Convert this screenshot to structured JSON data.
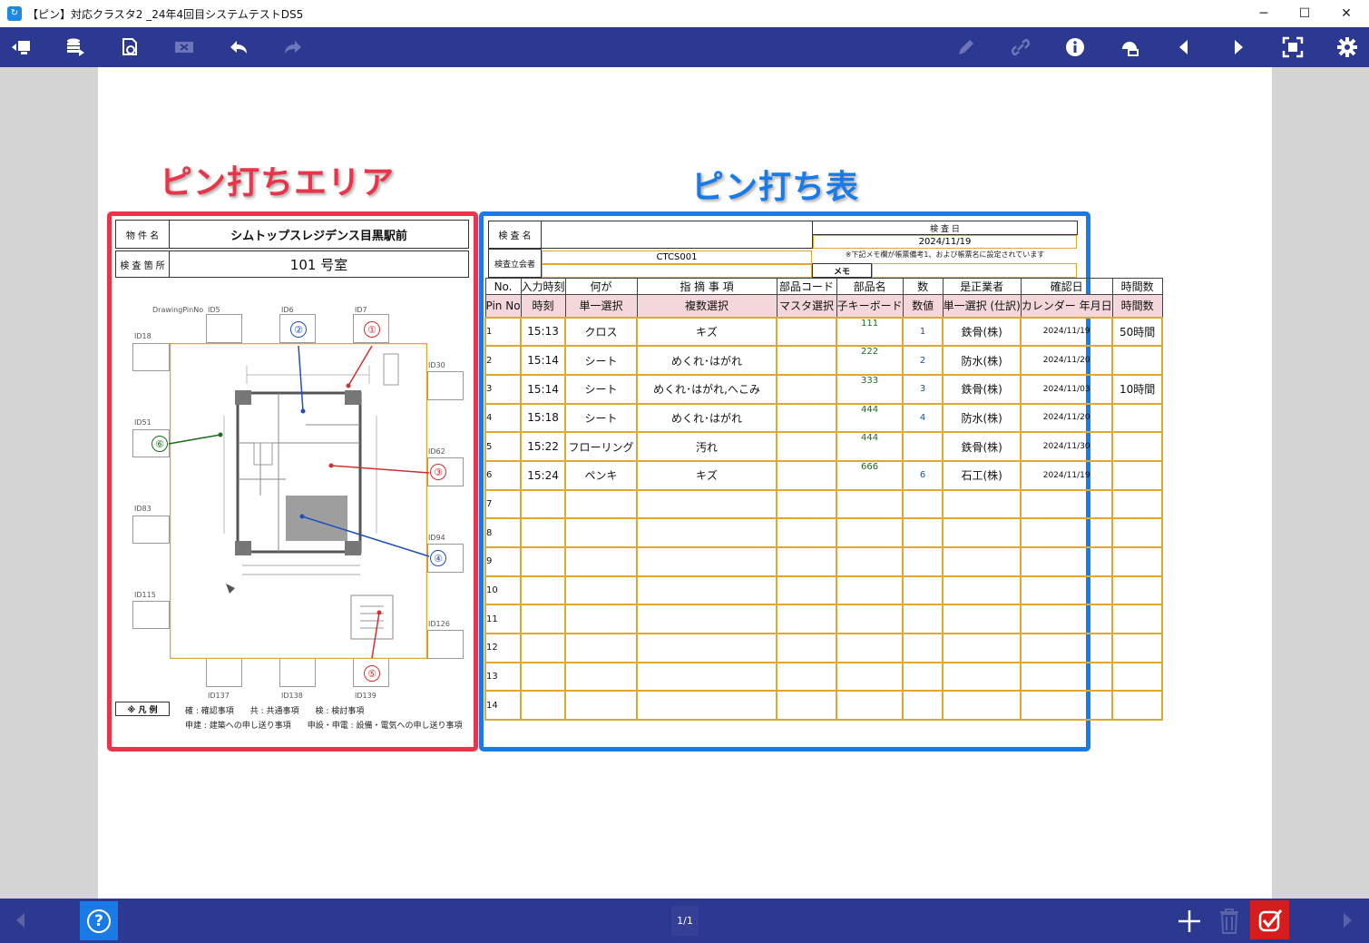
{
  "window": {
    "title": "【ピン】対応クラスタ2 _24年4回目システムテストDS5"
  },
  "toolbar": {
    "icons": [
      "exit-icon",
      "data-icon",
      "reload-icon",
      "delete-x-icon",
      "undo-icon",
      "redo-icon",
      "pen-icon",
      "link-icon",
      "info-icon",
      "cloud-icon",
      "prev-icon",
      "next-icon",
      "fit-icon",
      "gear-icon"
    ]
  },
  "headings": {
    "pin_area": "ピン打ちエリア",
    "pin_table": "ピン打ち表"
  },
  "pin_sheet": {
    "property_label": "物 件 名",
    "property_value": "シムトップスレジデンス目黒駅前",
    "location_label": "検 査 箇 所",
    "location_value": "101 号室",
    "drawing_label": "DrawingPinNo",
    "ids": [
      "ID5",
      "ID6",
      "ID7",
      "ID18",
      "ID30",
      "ID51",
      "ID62",
      "ID83",
      "ID94",
      "ID115",
      "ID126",
      "ID137",
      "ID138",
      "ID139"
    ],
    "pins": [
      "①",
      "②",
      "③",
      "④",
      "⑤",
      "⑥"
    ],
    "legend_label": "※ 凡 例",
    "legend_line1": "確 : 確認事項　　共 : 共通事項　　検 : 検討事項",
    "legend_line2": "申建 : 建築への申し送り事項　　申設・申電 : 設備・電気への申し送り事項"
  },
  "pin_table": {
    "inspector_label": "検 査 名",
    "inspector_value": "",
    "witness_label": "検査立会者",
    "witness_value": "CTCS001",
    "date_label": "検 査 日",
    "date_value": "2024/11/19",
    "note": "※下記メモ欄が帳票備考1、および帳票名に設定されています",
    "memo_label": "メモ",
    "headers": [
      "No.",
      "入力時刻",
      "何が",
      "指 摘 事 項",
      "部品コード",
      "部品名",
      "数",
      "是正業者",
      "確認日",
      "時間数"
    ],
    "subheaders": [
      "Pin No",
      "時刻",
      "単一選択",
      "複数選択",
      "マスタ選択",
      "子キーボード",
      "数値",
      "単一選択 (仕訳)",
      "カレンダー 年月日",
      "時間数"
    ],
    "rows": [
      {
        "no": "1",
        "time": "15:13",
        "what": "クロス",
        "issue": "キズ",
        "code": "",
        "part": "111",
        "qty": "1",
        "vendor": "鉄骨(株)",
        "date": "2024/11/19",
        "hours": "50時間"
      },
      {
        "no": "2",
        "time": "15:14",
        "what": "シート",
        "issue": "めくれ･はがれ",
        "code": "",
        "part": "222",
        "qty": "2",
        "vendor": "防水(株)",
        "date": "2024/11/20",
        "hours": ""
      },
      {
        "no": "3",
        "time": "15:14",
        "what": "シート",
        "issue": "めくれ･はがれ,へこみ",
        "code": "",
        "part": "333",
        "qty": "3",
        "vendor": "鉄骨(株)",
        "date": "2024/11/03",
        "hours": "10時間"
      },
      {
        "no": "4",
        "time": "15:18",
        "what": "シート",
        "issue": "めくれ･はがれ",
        "code": "",
        "part": "444",
        "qty": "4",
        "vendor": "防水(株)",
        "date": "2024/11/20",
        "hours": ""
      },
      {
        "no": "5",
        "time": "15:22",
        "what": "フローリング",
        "issue": "汚れ",
        "code": "",
        "part": "444",
        "qty": "",
        "vendor": "鉄骨(株)",
        "date": "2024/11/30",
        "hours": ""
      },
      {
        "no": "6",
        "time": "15:24",
        "what": "ペンキ",
        "issue": "キズ",
        "code": "",
        "part": "666",
        "qty": "6",
        "vendor": "石工(株)",
        "date": "2024/11/19",
        "hours": ""
      },
      {
        "no": "7",
        "time": "",
        "what": "",
        "issue": "",
        "code": "",
        "part": "",
        "qty": "",
        "vendor": "",
        "date": "",
        "hours": ""
      },
      {
        "no": "8",
        "time": "",
        "what": "",
        "issue": "",
        "code": "",
        "part": "",
        "qty": "",
        "vendor": "",
        "date": "",
        "hours": ""
      },
      {
        "no": "9",
        "time": "",
        "what": "",
        "issue": "",
        "code": "",
        "part": "",
        "qty": "",
        "vendor": "",
        "date": "",
        "hours": ""
      },
      {
        "no": "10",
        "time": "",
        "what": "",
        "issue": "",
        "code": "",
        "part": "",
        "qty": "",
        "vendor": "",
        "date": "",
        "hours": ""
      },
      {
        "no": "11",
        "time": "",
        "what": "",
        "issue": "",
        "code": "",
        "part": "",
        "qty": "",
        "vendor": "",
        "date": "",
        "hours": ""
      },
      {
        "no": "12",
        "time": "",
        "what": "",
        "issue": "",
        "code": "",
        "part": "",
        "qty": "",
        "vendor": "",
        "date": "",
        "hours": ""
      },
      {
        "no": "13",
        "time": "",
        "what": "",
        "issue": "",
        "code": "",
        "part": "",
        "qty": "",
        "vendor": "",
        "date": "",
        "hours": ""
      },
      {
        "no": "14",
        "time": "",
        "what": "",
        "issue": "",
        "code": "",
        "part": "",
        "qty": "",
        "vendor": "",
        "date": "",
        "hours": ""
      }
    ]
  },
  "bottombar": {
    "page_indicator": "1/1",
    "help": "?"
  },
  "colors": {
    "bar": "#2b3990",
    "pin_area_border": "#e8354a",
    "pin_table_border": "#1a7ae6",
    "grid": "#e0a82e"
  }
}
